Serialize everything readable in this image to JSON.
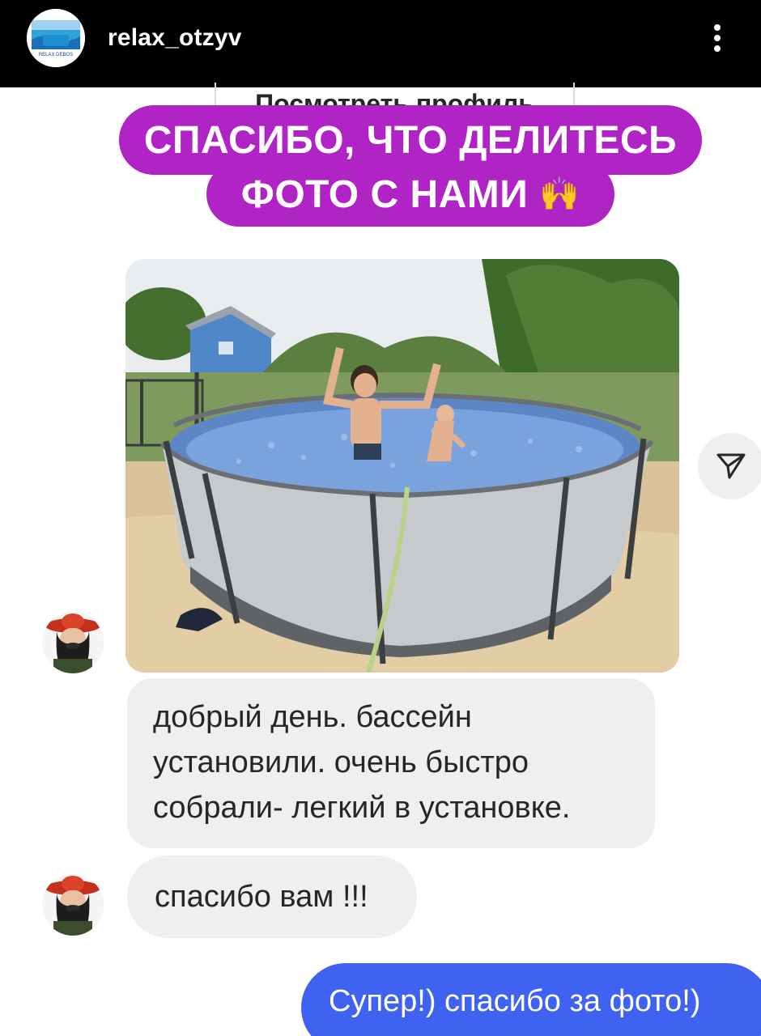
{
  "header": {
    "username": "relax_otzyv",
    "avatar_text": "RELAX DEBOS"
  },
  "story": {
    "view_profile_label": "Посмотреть профиль",
    "sticker_line1": "СПАСИБО, ЧТО ДЕЛИТЕСЬ",
    "sticker_line2": "ФОТО С НАМИ",
    "sticker_emoji": "🙌",
    "sticker_color": "#b023c4"
  },
  "messages": [
    {
      "direction": "incoming",
      "type": "photo",
      "description_icon": "pool-photo"
    },
    {
      "direction": "incoming",
      "type": "text",
      "lines": [
        "добрый день. бассейн",
        "установили. очень быстро",
        "собрали- легкий в установке."
      ]
    },
    {
      "direction": "incoming",
      "type": "text",
      "text": "спасибо вам !!!"
    },
    {
      "direction": "outgoing",
      "type": "text",
      "text": "Супер!) спасибо за фото!)"
    }
  ],
  "colors": {
    "header_bg": "#000000",
    "incoming_bubble": "#efefef",
    "outgoing_bubble": "#3f62f0"
  },
  "icons": {
    "more": "more-vertical-icon",
    "share": "send-icon"
  }
}
